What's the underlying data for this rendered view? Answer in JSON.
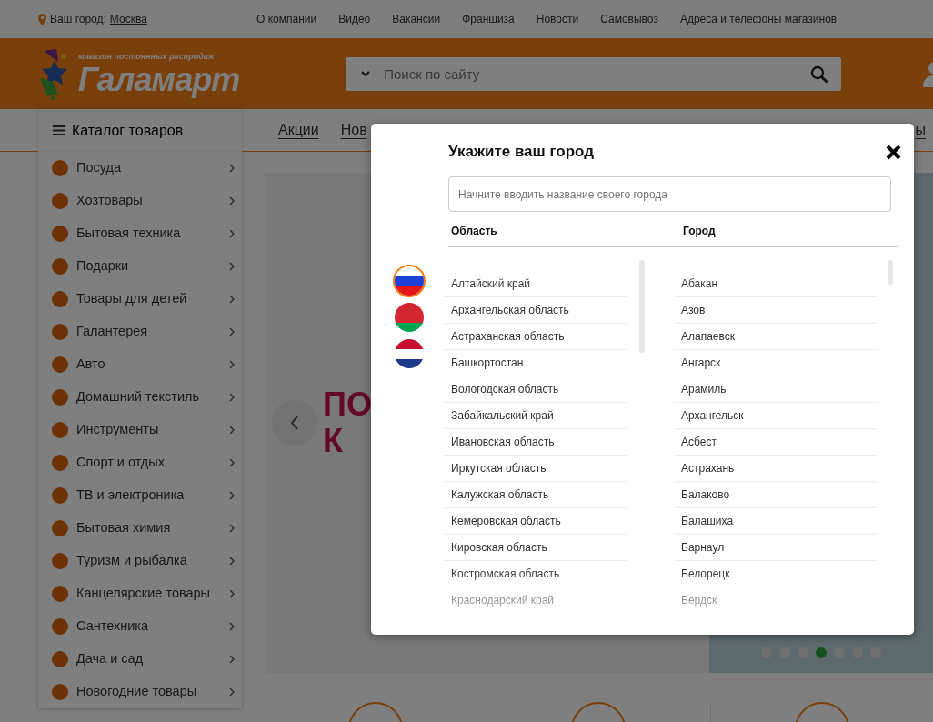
{
  "top_bar": {
    "city_label": "Ваш город:",
    "city": "Москва",
    "links": [
      "О компании",
      "Видео",
      "Вакансии",
      "Франшиза",
      "Новости",
      "Самовывоз",
      "Адреса и телефоны магазинов"
    ]
  },
  "header": {
    "logo": {
      "name": "Галамарт",
      "tagline": "магазин постоянных распродаж"
    },
    "search": {
      "placeholder": "Поиск по сайту"
    }
  },
  "nav": {
    "catalog_button": "Каталог товаров",
    "links": [
      "Акции",
      "Нов"
    ],
    "right_fragment": "ы"
  },
  "catalog": [
    {
      "label": "Посуда"
    },
    {
      "label": "Хозтовары"
    },
    {
      "label": "Бытовая техника"
    },
    {
      "label": "Подарки"
    },
    {
      "label": "Товары для детей"
    },
    {
      "label": "Галантерея"
    },
    {
      "label": "Авто"
    },
    {
      "label": "Домашний текстиль"
    },
    {
      "label": "Инструменты"
    },
    {
      "label": "Спорт и отдых"
    },
    {
      "label": "ТВ и электроника"
    },
    {
      "label": "Бытовая химия"
    },
    {
      "label": "Туризм и рыбалка"
    },
    {
      "label": "Канцелярские товары"
    },
    {
      "label": "Сантехника"
    },
    {
      "label": "Дача и сад"
    },
    {
      "label": "Новогодние товары"
    }
  ],
  "banner": {
    "lines": [
      "ПО",
      "К"
    ],
    "dots": [
      {
        "selected": false
      },
      {
        "selected": false
      },
      {
        "selected": false
      },
      {
        "selected": true
      },
      {
        "selected": false
      },
      {
        "selected": false
      },
      {
        "selected": false
      }
    ]
  },
  "modal": {
    "title": "Укажите ваш город",
    "search": {
      "placeholder": "Начните вводить название своего города"
    },
    "columns": [
      "Область",
      "Город"
    ],
    "countries": [
      {
        "kind": "ru",
        "selected": true
      },
      {
        "kind": "by",
        "selected": false
      },
      {
        "kind": "nl",
        "selected": false
      }
    ],
    "regions": [
      "Алтайский край",
      "Архангельская область",
      "Астраханская область",
      "Башкортостан",
      "Вологодская область",
      "Забайкальский край",
      "Ивановская область",
      "Иркутская область",
      "Калужская область",
      "Кемеровская область",
      "Кировская область",
      "Костромская область",
      "Краснодарский край"
    ],
    "cities": [
      "Абакан",
      "Азов",
      "Алапаевск",
      "Ангарск",
      "Арамиль",
      "Архангельск",
      "Асбест",
      "Астрахань",
      "Балаково",
      "Балашиха",
      "Барнаул",
      "Белорецк",
      "Бердск"
    ]
  }
}
